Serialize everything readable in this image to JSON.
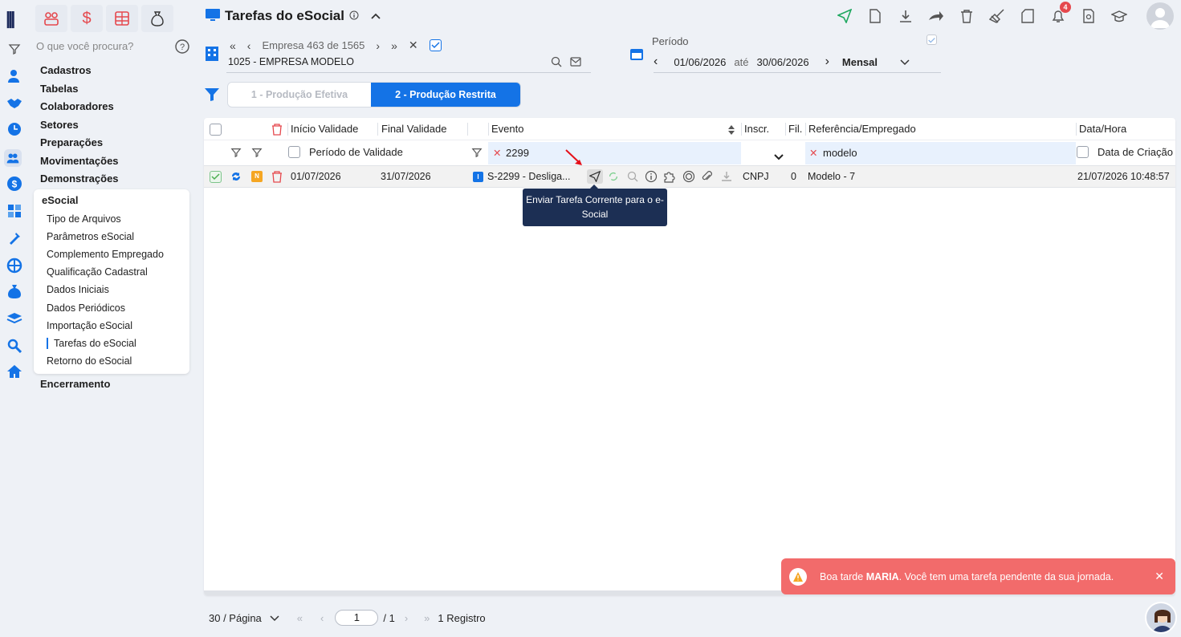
{
  "header": {
    "title": "Tarefas do eSocial",
    "notifications": "4"
  },
  "search": {
    "placeholder": "O que você procura?"
  },
  "menu": {
    "items": [
      "Cadastros",
      "Tabelas",
      "Colaboradores",
      "Setores",
      "Preparações",
      "Movimentações",
      "Demonstrações"
    ],
    "section": "eSocial",
    "sub_items": [
      "Tipo de Arquivos",
      "Parâmetros eSocial",
      "Complemento Empregado",
      "Qualificação Cadastral",
      "Dados Iniciais",
      "Dados Periódicos",
      "Importação eSocial",
      "Tarefas do eSocial",
      "Retorno do eSocial"
    ],
    "last": "Encerramento"
  },
  "empresa": {
    "counter": "Empresa 463 de 1565",
    "name": "1025 - EMPRESA MODELO"
  },
  "periodo": {
    "label": "Período",
    "from": "01/06/2026",
    "sep": "até",
    "to": "30/06/2026",
    "type": "Mensal"
  },
  "tabs": [
    "1 - Produção Efetiva",
    "2 - Produção Restrita"
  ],
  "grid": {
    "headers": {
      "inicio": "Início Validade",
      "final": "Final Validade",
      "evento": "Evento",
      "inscr": "Inscr.",
      "fil": "Fil.",
      "ref": "Referência/Empregado",
      "data": "Data/Hora"
    },
    "filters": {
      "periodo": "Período de Validade",
      "evento": "2299",
      "ref": "modelo",
      "data": "Data de Criação"
    },
    "row": {
      "badge": "N",
      "inicio": "01/07/2026",
      "final": "31/07/2026",
      "tag": "I",
      "evento": "S-2299 - Desliga...",
      "inscr": "CNPJ",
      "fil": "0",
      "ref": "Modelo - 7",
      "data": "21/07/2026 10:48:57"
    }
  },
  "tooltip": "Enviar Tarefa Corrente para o e-Social",
  "pager": {
    "size": "30 / Página",
    "page": "1",
    "total": "/ 1",
    "records": "1 Registro"
  },
  "toast": {
    "pre": "Boa tarde ",
    "name": "MARIA",
    "post": ". Você tem uma tarefa pendente da sua jornada.",
    "close": "✕"
  },
  "colors": {
    "accent": "#1473e6",
    "toast": "#f26b6b",
    "tooltip": "#1c2f54"
  }
}
